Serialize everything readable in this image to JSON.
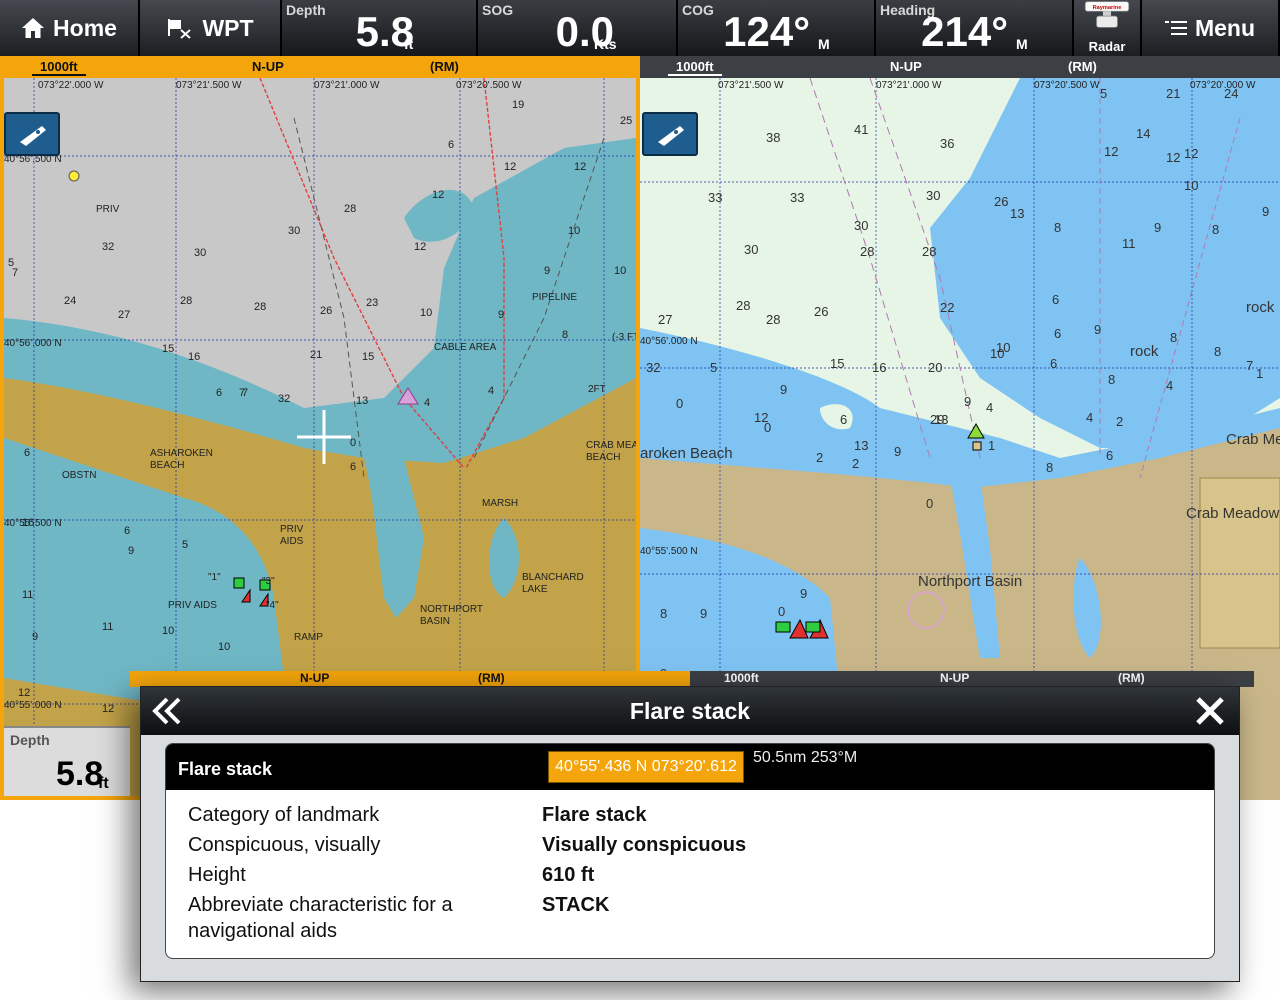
{
  "topbar": {
    "home_label": "Home",
    "wpt_label": "WPT",
    "depth": {
      "label": "Depth",
      "value": "5.8",
      "unit": "ft"
    },
    "sog": {
      "label": "SOG",
      "value": "0.0",
      "unit": "Kts"
    },
    "cog": {
      "label": "COG",
      "value": "124°",
      "unit": "M"
    },
    "heading": {
      "label": "Heading",
      "value": "214°",
      "unit": "M"
    },
    "radar_label": "Radar",
    "radar_brand": "Raymarine",
    "menu_label": "Menu"
  },
  "left_chart": {
    "scale": "1000ft",
    "orientation": "N-UP",
    "motion": "(RM)",
    "lon_labels": [
      "073°22'.000 W",
      "073°21'.500 W",
      "073°21'.000 W",
      "073°20'.500 W"
    ],
    "lat_labels": [
      "40°56'.500 N",
      "40°56'.000 N",
      "40°55'.500 N",
      "40°55'.000 N"
    ],
    "labels": [
      "PRIV",
      "PIPELINE",
      "CABLE AREA",
      "ASHAROKEN",
      "BEACH",
      "OBSTN",
      "CRAB MEA",
      "BEACH",
      "MARSH",
      "PRIV",
      "AIDS",
      "BLANCHARD",
      "LAKE",
      "NORTHPORT",
      "BASIN",
      "PRIV AIDS",
      "RAMP",
      "2FT",
      "(-3 FT)",
      "\"1\"",
      "\"3\"",
      "\"4\""
    ],
    "soundings": [
      "19",
      "25",
      "12",
      "12",
      "6",
      "12",
      "10",
      "32",
      "30",
      "30",
      "28",
      "12",
      "10",
      "9",
      "24",
      "27",
      "28",
      "28",
      "26",
      "23",
      "10",
      "9",
      "8",
      "7",
      "15",
      "16",
      "21",
      "15",
      "13",
      "4",
      "4",
      "32",
      "6",
      "7",
      "6",
      "0",
      "6",
      "6",
      "9",
      "5",
      "11",
      "10",
      "11",
      "9",
      "10",
      "12",
      "16",
      "12",
      "5",
      "7"
    ],
    "mini_depth": {
      "label": "Depth",
      "value": "5.8",
      "unit": "ft"
    }
  },
  "right_chart": {
    "scale": "1000ft",
    "orientation": "N-UP",
    "motion": "(RM)",
    "lon_labels": [
      "073°21'.500 W",
      "073°21'.000 W",
      "073°20'.500 W",
      "073°20'.000 W"
    ],
    "lat_labels": [
      "40°56'.000 N",
      "40°55'.500 N"
    ],
    "labels": [
      "aroken Beach",
      "Crab Me",
      "Crab Meadow",
      "Northport Basin",
      "rock",
      "rock"
    ],
    "soundings": [
      "38",
      "41",
      "36",
      "33",
      "33",
      "30",
      "26",
      "13",
      "30",
      "30",
      "28",
      "22",
      "28",
      "28",
      "28",
      "26",
      "27",
      "32",
      "5",
      "15",
      "16",
      "20",
      "13",
      "9",
      "12",
      "6",
      "29",
      "13",
      "10",
      "9",
      "4",
      "0",
      "0",
      "2",
      "2",
      "9",
      "1",
      "0",
      "6",
      "4",
      "2",
      "8",
      "5",
      "21",
      "24",
      "14",
      "12",
      "12",
      "12",
      "10",
      "11",
      "9",
      "9",
      "8",
      "8",
      "6",
      "6",
      "10",
      "6",
      "8",
      "8",
      "1",
      "9",
      "8",
      "4",
      "7",
      "9",
      "9",
      "8",
      "9",
      "0"
    ]
  },
  "bottom_strip_left": {
    "orientation": "N-UP",
    "motion": "(RM)"
  },
  "bottom_strip_right": {
    "scale": "1000ft",
    "orientation": "N-UP",
    "motion": "(RM)"
  },
  "dialog": {
    "title": "Flare stack",
    "object_name": "Flare stack",
    "position": "40°55'.436 N 073°20'.612 W",
    "range_bearing": "50.5nm 253°M",
    "rows": [
      {
        "key": "Category of landmark",
        "value": "Flare stack"
      },
      {
        "key": "Conspicuous, visually",
        "value": "Visually conspicuous"
      },
      {
        "key": "Height",
        "value": "610 ft"
      },
      {
        "key": "Abbreviate characteristic for a navigational aids",
        "value": "STACK"
      }
    ]
  },
  "colors": {
    "accent": "#f4a50c",
    "land": "#c2a349",
    "water_left": "#6fb7c5",
    "deep_left": "#c8c8c8",
    "water_right": "#7fc3f2",
    "deep_right": "#e6f5e6"
  }
}
